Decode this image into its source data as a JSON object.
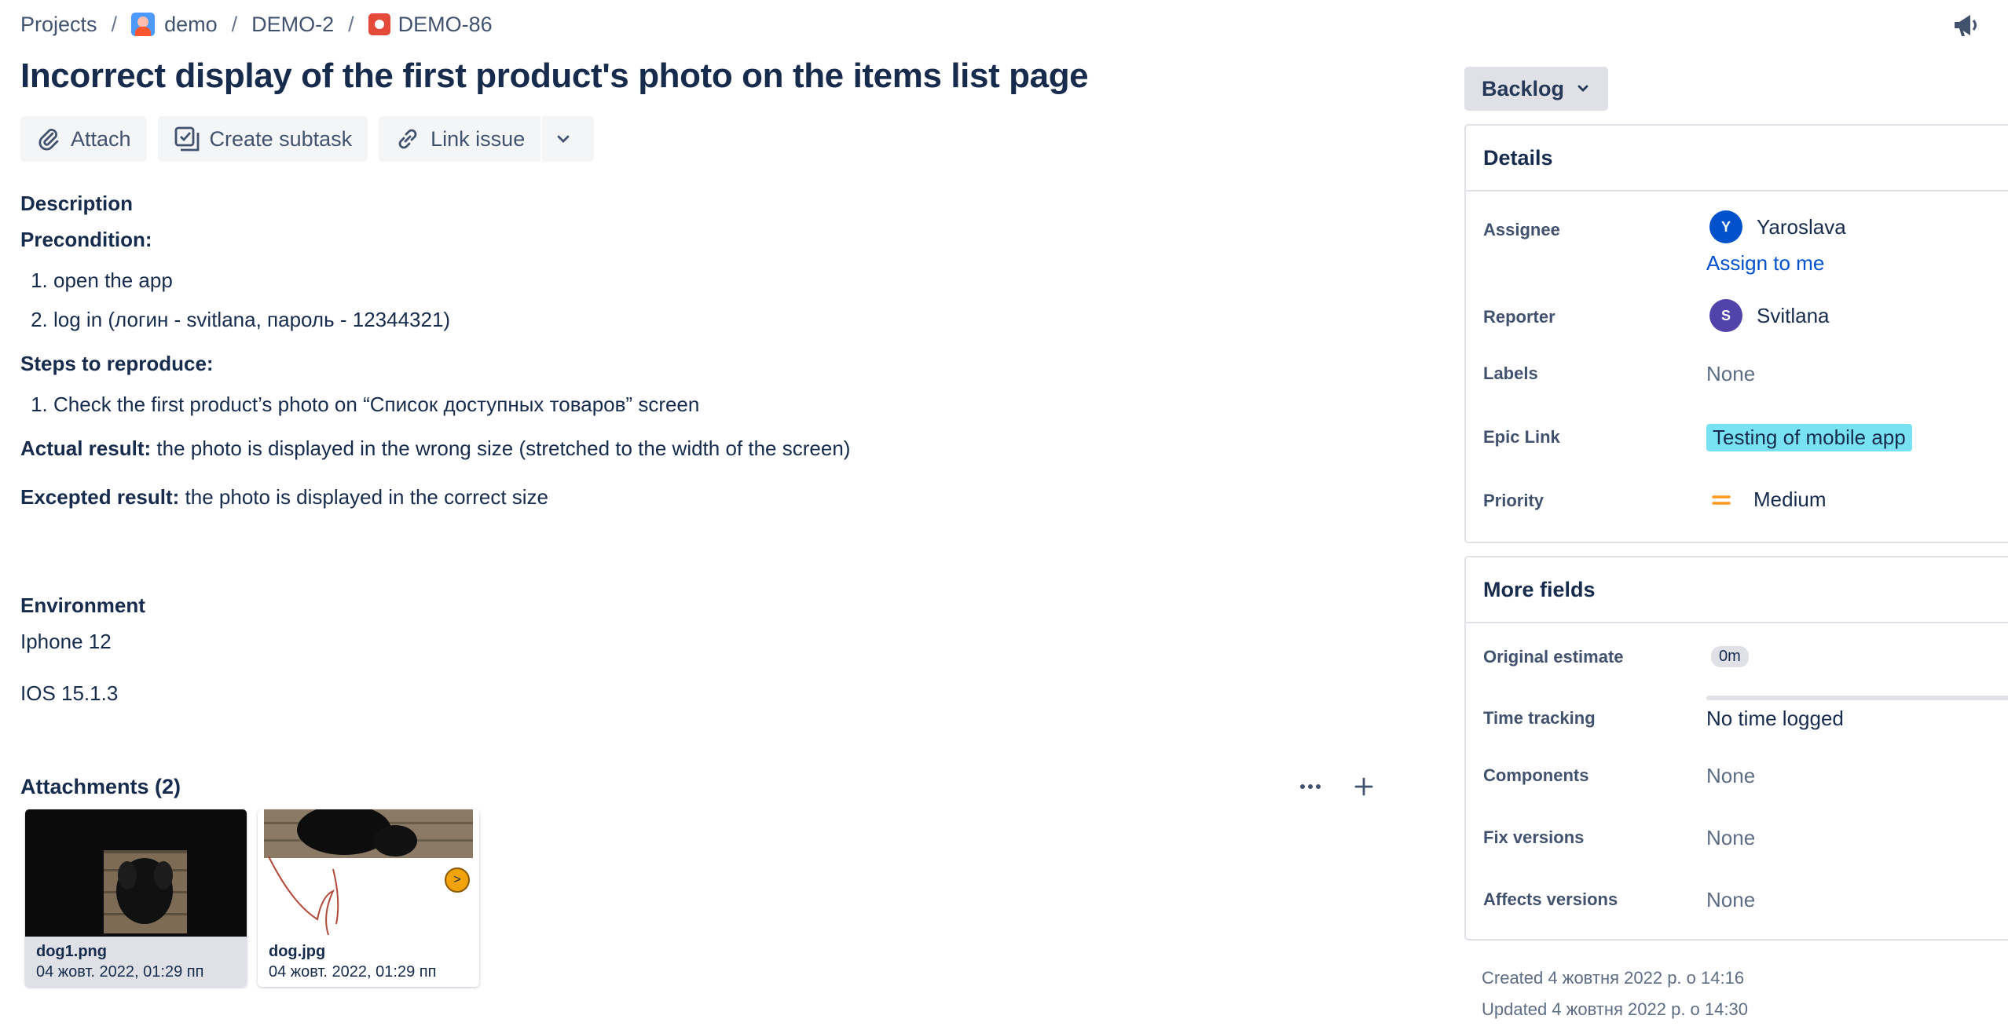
{
  "breadcrumb": {
    "projects": "Projects",
    "project": "demo",
    "epic": "DEMO-2",
    "issue": "DEMO-86",
    "separator": "/"
  },
  "issue": {
    "title": "Incorrect display of the first product's photo on the items list page"
  },
  "toolbar": {
    "attach": "Attach",
    "create_subtask": "Create subtask",
    "link_issue": "Link issue"
  },
  "description": {
    "heading": "Description",
    "precondition_label": "Precondition:",
    "preconditions": [
      "open the app",
      "log in (логин - svitlana, пароль - 12344321)"
    ],
    "steps_label": "Steps to reproduce:",
    "steps": [
      "Check the first product’s photo on “Список доступных товаров” screen"
    ],
    "actual_label": "Actual result:",
    "actual_text": "the photo is displayed in the wrong size (stretched to the width of the screen)",
    "expected_label": "Excepted result:",
    "expected_text": "the photo is displayed in the correct size"
  },
  "environment": {
    "heading": "Environment",
    "lines": [
      "Iphone 12",
      "IOS 15.1.3"
    ]
  },
  "attachments": {
    "heading": "Attachments (2)",
    "more_icon": "ellipsis-icon",
    "add_icon": "plus-icon",
    "files": [
      {
        "name": "dog1.png",
        "date": "04 жовт. 2022, 01:29 пп"
      },
      {
        "name": "dog.jpg",
        "date": "04 жовт. 2022, 01:29 пп",
        "badge": ">"
      }
    ]
  },
  "status": {
    "label": "Backlog"
  },
  "details": {
    "heading": "Details",
    "assignee_label": "Assignee",
    "assignee_name": "Yaroslava",
    "assignee_initial": "Y",
    "assign_to_me": "Assign to me",
    "reporter_label": "Reporter",
    "reporter_name": "Svitlana",
    "reporter_initial": "S",
    "labels_label": "Labels",
    "labels_value": "None",
    "epic_label": "Epic Link",
    "epic_value": "Testing of mobile app",
    "priority_label": "Priority",
    "priority_value": "Medium"
  },
  "more_fields": {
    "heading": "More fields",
    "original_estimate_label": "Original estimate",
    "original_estimate_value": "0m",
    "time_tracking_label": "Time tracking",
    "time_tracking_value": "No time logged",
    "time_tracking_progress": 0,
    "components_label": "Components",
    "components_value": "None",
    "fix_versions_label": "Fix versions",
    "fix_versions_value": "None",
    "affects_versions_label": "Affects versions",
    "affects_versions_value": "None"
  },
  "footer": {
    "created": "Created 4 жовтня 2022 р. о 14:16",
    "updated": "Updated 4 жовтня 2022 р. о 14:30"
  },
  "colors": {
    "text": "#172b4d",
    "link": "#0052cc",
    "assignee_avatar": "#0052cc",
    "reporter_avatar": "#5243aa",
    "epic_bg": "#79e2f2",
    "priority_medium": "#ff991f",
    "bug": "#e5493a"
  }
}
